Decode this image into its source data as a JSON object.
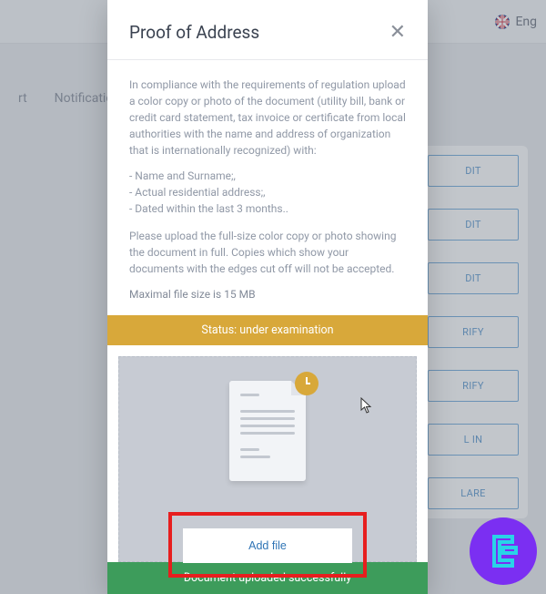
{
  "topbar": {
    "language": "Eng"
  },
  "bg": {
    "tabs": [
      "rt",
      "Notifications"
    ],
    "buttons": [
      "DIT",
      "DIT",
      "DIT",
      "RIFY",
      "RIFY",
      "L IN",
      "LARE"
    ]
  },
  "modal": {
    "title": "Proof of Address",
    "intro": "In compliance with the requirements of regulation upload a color copy or photo of the document (utility bill, bank or credit card statement, tax invoice or certificate from local authorities with the name and address of organization that is internationally recognized) with:",
    "bullets": [
      "- Name and Surname;,",
      "- Actual residential address;,",
      "- Dated within the last 3 months.."
    ],
    "note": "Please upload the full-size color copy or photo showing the document in full. Copies which show your documents with the edges cut off will not be accepted.",
    "max_size": "Maximal file size is 15 MB",
    "status": "Status: under examination",
    "add_file": "Add file",
    "success": "Document uploaded successfully"
  }
}
